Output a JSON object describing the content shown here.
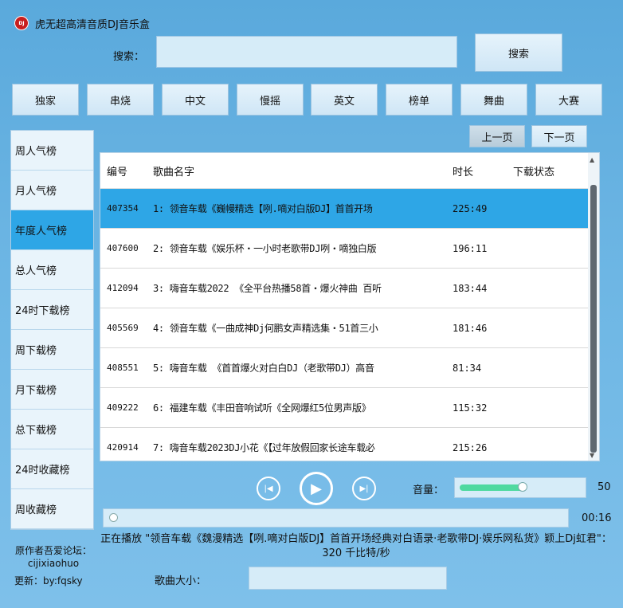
{
  "app": {
    "title": "虎无超高清音质DJ音乐盒",
    "logo_text": "DJ"
  },
  "search": {
    "label": "搜索：",
    "value": "",
    "button_label": "搜索"
  },
  "categories": [
    "独家",
    "串烧",
    "中文",
    "慢摇",
    "英文",
    "榜单",
    "舞曲",
    "大赛"
  ],
  "sidebar": {
    "items": [
      "周人气榜",
      "月人气榜",
      "年度人气榜",
      "总人气榜",
      "24时下载榜",
      "周下载榜",
      "月下载榜",
      "总下载榜",
      "24时收藏榜",
      "周收藏榜"
    ],
    "active_index": 2
  },
  "pagination": {
    "prev_label": "上一页",
    "next_label": "下一页"
  },
  "table": {
    "headers": {
      "id": "编号",
      "name": "歌曲名字",
      "duration": "时长",
      "status": "下载状态"
    },
    "rows": [
      {
        "id": "407354",
        "name": "1: 领音车载《巍幔精选【咧.嘀对白版DJ】首首开场",
        "duration": "225:49",
        "status": ""
      },
      {
        "id": "407600",
        "name": "2: 领音车载《娱乐杯・一小时老歌带DJ咧・嘀独白版",
        "duration": "196:11",
        "status": ""
      },
      {
        "id": "412094",
        "name": "3: 嗨音车载2022 《全平台热播58首・爆火神曲 百听",
        "duration": "183:44",
        "status": ""
      },
      {
        "id": "405569",
        "name": "4: 领音车载《一曲成神Dj何鹏女声精选集・51首三小",
        "duration": "181:46",
        "status": ""
      },
      {
        "id": "408551",
        "name": "5: 嗨音车载 《首首爆火对白白DJ（老歌带DJ）高音",
        "duration": "81:34",
        "status": ""
      },
      {
        "id": "409222",
        "name": "6: 福建车载《丰田音响试听《全网爆红5位男声版》",
        "duration": "115:32",
        "status": ""
      },
      {
        "id": "420914",
        "name": "7: 嗨音车载2023DJ小花《【过年放假回家长途车载必",
        "duration": "215:26",
        "status": ""
      }
    ],
    "selected_index": 0
  },
  "player": {
    "volume_label": "音量：",
    "volume_value": "50",
    "volume_fraction": 0.5,
    "progress_time": "00:16",
    "progress_fraction": 0.01,
    "now_playing": "正在播放 \"领音车载《魏漫精选【咧.嘀对白版DJ】首首开场经典对白语录·老歌带DJ·娱乐网私货》颖上Dj虹君\"：320 千比特/秒"
  },
  "footer": {
    "author_line1": "原作者吾爱论坛：",
    "author_line2": "cijixiaohuo",
    "update": "更新：by:fqsky",
    "size_label": "歌曲大小："
  },
  "colors": {
    "accent": "#2ea6e6",
    "background": "#6db6e4",
    "volume_fill": "#4fd9a0"
  }
}
